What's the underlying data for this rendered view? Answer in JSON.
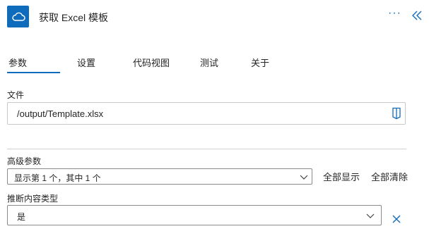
{
  "header": {
    "title": "获取 Excel 模板",
    "app_icon": "cloud-icon",
    "more_label": "···"
  },
  "tabs": [
    "参数",
    "设置",
    "代码视图",
    "测试",
    "关于"
  ],
  "fields": {
    "file": {
      "label": "文件",
      "value": "/output/Template.xlsx"
    },
    "advanced": {
      "label": "高级参数",
      "selected": "显示第 1 个，其中 1 个",
      "show_all": "全部显示",
      "clear_all": "全部清除"
    },
    "infer_types": {
      "label": "推断内容类型",
      "selected": "是"
    }
  },
  "colors": {
    "accent": "#0f6cbd"
  }
}
